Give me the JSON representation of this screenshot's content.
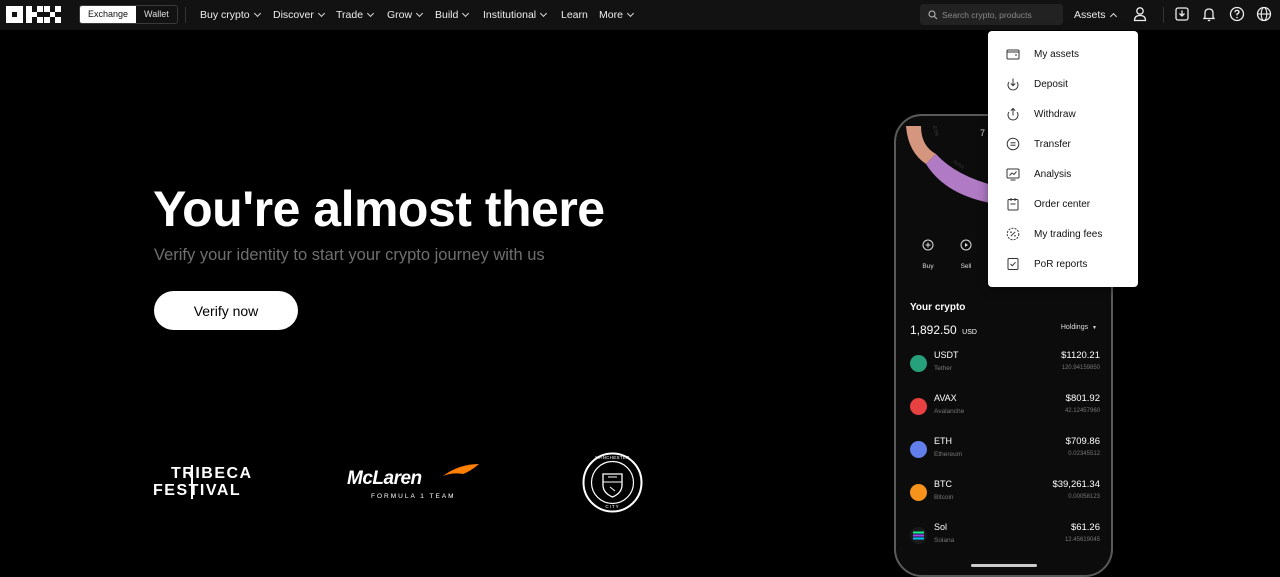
{
  "nav": {
    "logo_name": "OKX",
    "toggle": [
      "Exchange",
      "Wallet"
    ],
    "items": [
      "Buy crypto",
      "Discover",
      "Trade",
      "Grow",
      "Build",
      "Institutional",
      "Learn",
      "More"
    ],
    "search_placeholder": "Search crypto, products",
    "assets_label": "Assets"
  },
  "hero": {
    "title": "You're almost there",
    "subtitle": "Verify your identity to start your crypto journey with us",
    "cta": "Verify now"
  },
  "partners": {
    "tribeca_line1": "TRIBECA",
    "tribeca_line2": "FESTIVAL",
    "mclaren": "McLaren",
    "mclaren_sub": "FORMULA 1 TEAM",
    "city_top": "MANCHESTER",
    "city_bottom": "CITY"
  },
  "assets_menu": [
    "My assets",
    "Deposit",
    "Withdraw",
    "Transfer",
    "Analysis",
    "Order center",
    "My trading fees",
    "PoR reports"
  ],
  "phone": {
    "ring_labels": [
      "ETH",
      "AVAX"
    ],
    "ring_digit": "7",
    "actions": [
      "Buy",
      "Sell"
    ],
    "section_title": "Your crypto",
    "total": "1,892.50",
    "currency": "USD",
    "holdings_label": "Holdings",
    "coins": [
      {
        "symbol": "USDT",
        "name": "Tether",
        "value": "$1120.21",
        "amount": "120.94159850",
        "color": "#26a17b"
      },
      {
        "symbol": "AVAX",
        "name": "Avalanche",
        "value": "$801.92",
        "amount": "42.12457960",
        "color": "#e84142"
      },
      {
        "symbol": "ETH",
        "name": "Ethereum",
        "value": "$709.86",
        "amount": "0.02345512",
        "color": "#627eea"
      },
      {
        "symbol": "BTC",
        "name": "Bitcoin",
        "value": "$39,261.34",
        "amount": "0.00058123",
        "color": "#f7931a"
      },
      {
        "symbol": "Sol",
        "name": "Solana",
        "value": "$61.26",
        "amount": "12.45619045",
        "color": "#9945ff"
      }
    ]
  }
}
